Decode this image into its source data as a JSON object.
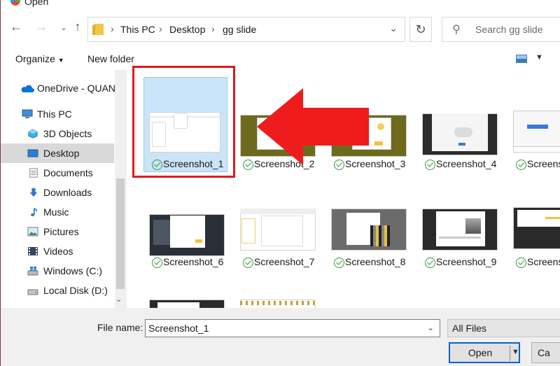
{
  "window": {
    "title": "Open"
  },
  "address": {
    "crumbs": [
      "This PC",
      "Desktop",
      "gg slide"
    ]
  },
  "search": {
    "placeholder": "Search gg slide"
  },
  "toolbar": {
    "organize": "Organize",
    "new_folder": "New folder"
  },
  "sidebar": {
    "items": [
      {
        "label": "OneDrive - QUAN",
        "icon": "onedrive-cloud-icon"
      },
      {
        "label": "This PC",
        "icon": "computer-icon"
      },
      {
        "label": "3D Objects",
        "icon": "3d-objects-icon"
      },
      {
        "label": "Desktop",
        "icon": "desktop-icon",
        "selected": true
      },
      {
        "label": "Documents",
        "icon": "documents-icon"
      },
      {
        "label": "Downloads",
        "icon": "download-arrow-icon"
      },
      {
        "label": "Music",
        "icon": "music-note-icon"
      },
      {
        "label": "Pictures",
        "icon": "pictures-icon"
      },
      {
        "label": "Videos",
        "icon": "film-icon"
      },
      {
        "label": "Windows (C:)",
        "icon": "windows-drive-icon"
      },
      {
        "label": "Local Disk (D:)",
        "icon": "disk-drive-icon"
      }
    ]
  },
  "files": [
    {
      "name": "Screenshot_1",
      "selected": true
    },
    {
      "name": "Screenshot_2"
    },
    {
      "name": "Screenshot_3"
    },
    {
      "name": "Screenshot_4"
    },
    {
      "name": "Screensh"
    },
    {
      "name": "Screenshot_6"
    },
    {
      "name": "Screenshot_7"
    },
    {
      "name": "Screenshot_8"
    },
    {
      "name": "Screenshot_9"
    },
    {
      "name": "Screensh"
    }
  ],
  "footer": {
    "file_name_label": "File name:",
    "file_name_value": "Screenshot_1",
    "file_type": "All Files",
    "open": "Open",
    "cancel": "Ca"
  },
  "colors": {
    "selection": "#cce4f7",
    "highlight_border": "#e0191c",
    "primary_button_border": "#0a64c8",
    "status_check": "#3a9a3a"
  }
}
